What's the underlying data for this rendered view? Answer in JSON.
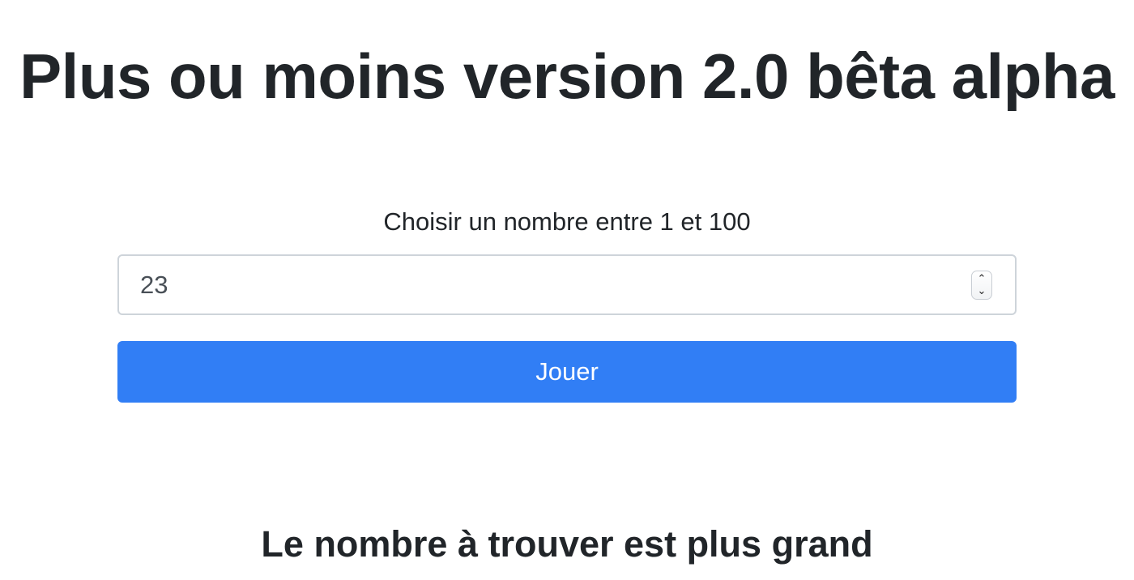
{
  "page": {
    "title": "Plus ou moins version 2.0 bêta alpha"
  },
  "form": {
    "label": "Choisir un nombre entre 1 et 100",
    "number_input": {
      "value": "23",
      "spinner_up_icon": "chevron-up",
      "spinner_down_icon": "chevron-down"
    },
    "play_button_label": "Jouer"
  },
  "result": {
    "message": "Le nombre à trouver est plus grand"
  },
  "colors": {
    "button_background": "#317ef5",
    "text": "#212529",
    "input_border": "#ced4da"
  }
}
